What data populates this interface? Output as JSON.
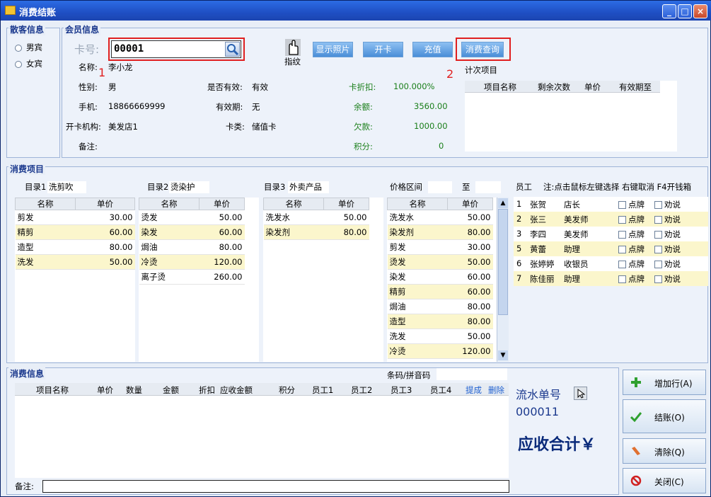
{
  "window": {
    "title": "消费结账"
  },
  "guest": {
    "title": "散客信息",
    "options": [
      "男宾",
      "女宾"
    ]
  },
  "member": {
    "title": "会员信息",
    "card_label": "卡号:",
    "card_value": "00001",
    "name_label": "名称:",
    "name_value": "李小龙",
    "gender_label": "性别:",
    "gender_value": "男",
    "valid_label": "是否有效:",
    "valid_value": "有效",
    "phone_label": "手机:",
    "phone_value": "18866669999",
    "expire_label": "有效期:",
    "expire_value": "无",
    "org_label": "开卡机构:",
    "org_value": "美发店1",
    "cardtype_label": "卡类:",
    "cardtype_value": "储值卡",
    "remark_label": "备注:",
    "discount_label": "卡折扣:",
    "discount_value": "100.000%",
    "balance_label": "余额:",
    "balance_value": "3560.00",
    "debt_label": "欠款:",
    "debt_value": "1000.00",
    "points_label": "积分:",
    "points_value": "0",
    "fingerprint_label": "指纹",
    "buttons": {
      "photo": "显示照片",
      "open": "开卡",
      "recharge": "充值",
      "query": "消费查询"
    },
    "annotations": [
      "1",
      "2"
    ],
    "count_title": "计次项目",
    "count_cols": [
      "项目名称",
      "剩余次数",
      "单价",
      "有效期至"
    ]
  },
  "items": {
    "title": "消费项目",
    "cat1_label": "目录1",
    "cat1_value": "洗剪吹",
    "cat2_label": "目录2",
    "cat2_value": "烫染护",
    "cat3_label": "目录3",
    "cat3_value": "外卖产品",
    "price_range_label": "价格区间",
    "price_to_label": "至",
    "col_name": "名称",
    "col_price": "单价",
    "cat1": [
      {
        "n": "剪发",
        "p": "30.00"
      },
      {
        "n": "精剪",
        "p": "60.00"
      },
      {
        "n": "造型",
        "p": "80.00"
      },
      {
        "n": "洗发",
        "p": "50.00"
      }
    ],
    "cat2": [
      {
        "n": "烫发",
        "p": "50.00"
      },
      {
        "n": "染发",
        "p": "60.00"
      },
      {
        "n": "焗油",
        "p": "80.00"
      },
      {
        "n": "冷烫",
        "p": "120.00"
      },
      {
        "n": "离子烫",
        "p": "260.00"
      }
    ],
    "cat3": [
      {
        "n": "洗发水",
        "p": "50.00"
      },
      {
        "n": "染发剂",
        "p": "80.00"
      }
    ],
    "range": [
      {
        "n": "洗发水",
        "p": "50.00"
      },
      {
        "n": "染发剂",
        "p": "80.00"
      },
      {
        "n": "剪发",
        "p": "30.00"
      },
      {
        "n": "烫发",
        "p": "50.00"
      },
      {
        "n": "染发",
        "p": "60.00"
      },
      {
        "n": "精剪",
        "p": "60.00"
      },
      {
        "n": "焗油",
        "p": "80.00"
      },
      {
        "n": "造型",
        "p": "80.00"
      },
      {
        "n": "洗发",
        "p": "50.00"
      },
      {
        "n": "冷烫",
        "p": "120.00"
      }
    ]
  },
  "staff": {
    "title": "员工",
    "note": "注:点击鼠标左键选择 右键取消 F4开钱箱",
    "point_label": "点牌",
    "persuade_label": "劝说",
    "rows": [
      {
        "no": "1",
        "name": "张贺",
        "role": "店长"
      },
      {
        "no": "2",
        "name": "张三",
        "role": "美发师"
      },
      {
        "no": "3",
        "name": "李四",
        "role": "美发师"
      },
      {
        "no": "5",
        "name": "黄蕾",
        "role": "助理"
      },
      {
        "no": "6",
        "name": "张婷婷",
        "role": "收银员"
      },
      {
        "no": "7",
        "name": "陈佳丽",
        "role": "助理"
      }
    ]
  },
  "consume": {
    "title": "消费信息",
    "barcode_label": "条码/拼音码",
    "cols": [
      "项目名称",
      "单价",
      "数量",
      "金额",
      "折扣",
      "应收金额",
      "积分",
      "员工1",
      "员工2",
      "员工3",
      "员工4"
    ],
    "link_commission": "提成",
    "link_delete": "删除",
    "remark_label": "备注:",
    "serial_label": "流水单号",
    "serial_value": "000011",
    "total_label": "应收合计￥"
  },
  "actions": {
    "add": "增加行(A)",
    "checkout": "结账(O)",
    "clear": "清除(Q)",
    "close": "关闭(C)"
  },
  "colors": {
    "title_bar": "#1f4fc4",
    "accent_blue": "#1c3a8e",
    "highlight_red": "#e02020",
    "alt_row": "#fbf6cc",
    "green": "#1a7f1a"
  }
}
